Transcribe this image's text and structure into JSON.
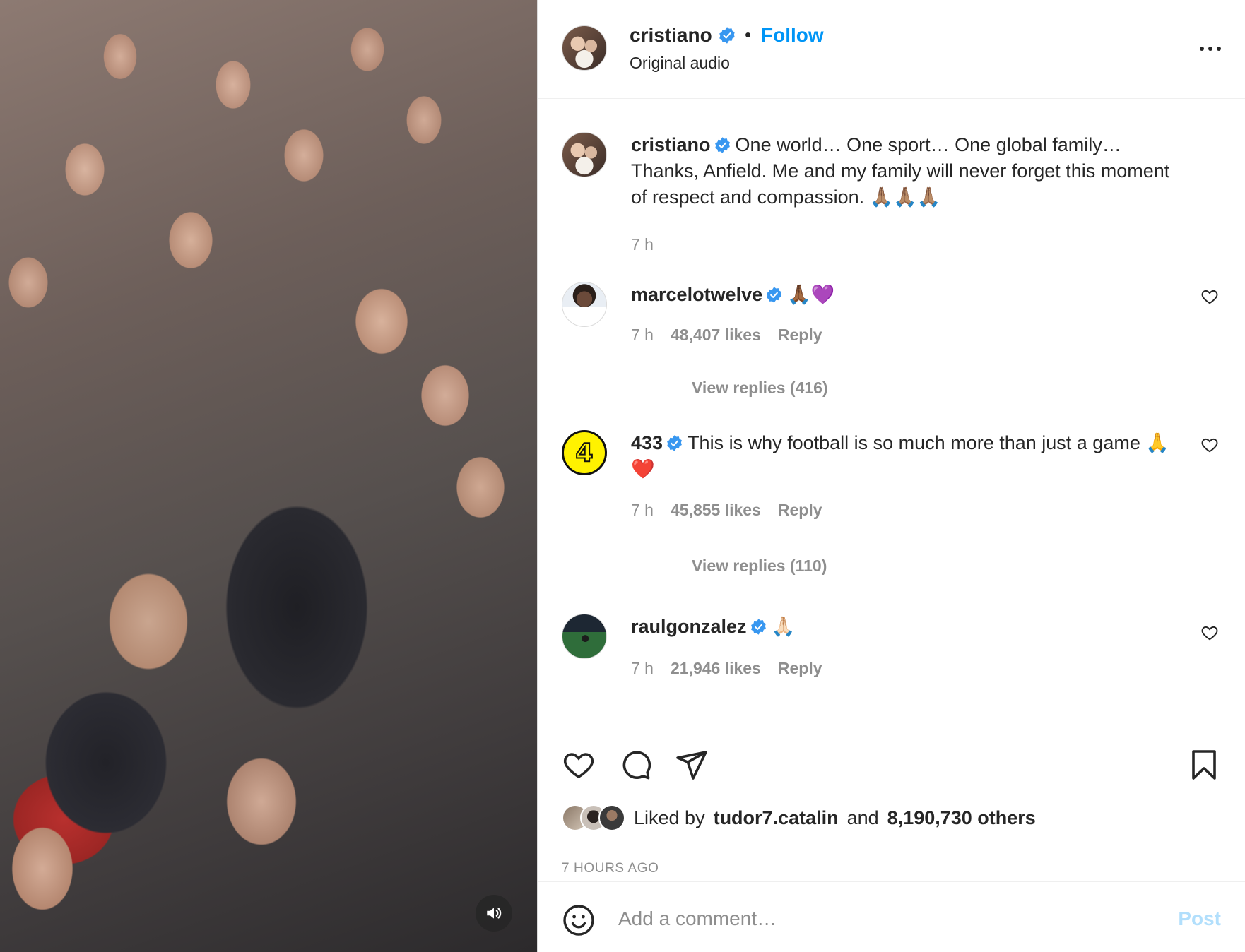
{
  "header": {
    "username": "cristiano",
    "separator": "•",
    "follow_label": "Follow",
    "subtitle": "Original audio"
  },
  "caption": {
    "username": "cristiano",
    "text": "One world… One sport… One global family… Thanks, Anfield. Me and my family will never forget this moment of respect and compassion. 🙏🏽🙏🏽🙏🏽",
    "time": "7 h"
  },
  "comments": [
    {
      "username": "marcelotwelve",
      "text": "🙏🏾💜",
      "time": "7 h",
      "likes": "48,407 likes",
      "reply_label": "Reply",
      "view_replies": "View replies (416)"
    },
    {
      "username": "433",
      "avatar_label": "4",
      "text": "This is why football is so much more than just a game 🙏❤️",
      "time": "7 h",
      "likes": "45,855 likes",
      "reply_label": "Reply",
      "view_replies": "View replies (110)"
    },
    {
      "username": "raulgonzalez",
      "text": "🙏🏻",
      "time": "7 h",
      "likes": "21,946 likes",
      "reply_label": "Reply"
    }
  ],
  "likes": {
    "prefix": "Liked by",
    "user": "tudor7.catalin",
    "and": "and",
    "others": "8,190,730 others"
  },
  "time_ago": "7 HOURS AGO",
  "comment_box": {
    "placeholder": "Add a comment…",
    "post_label": "Post"
  },
  "colors": {
    "accent": "#0095f6",
    "verified": "#3897f0",
    "muted": "#8e8e8e",
    "post_disabled": "#b2dffc"
  },
  "icons": [
    "speaker-icon",
    "more-icon",
    "verified-icon",
    "heart-icon",
    "comment-icon",
    "share-icon",
    "bookmark-icon",
    "emoji-icon"
  ]
}
